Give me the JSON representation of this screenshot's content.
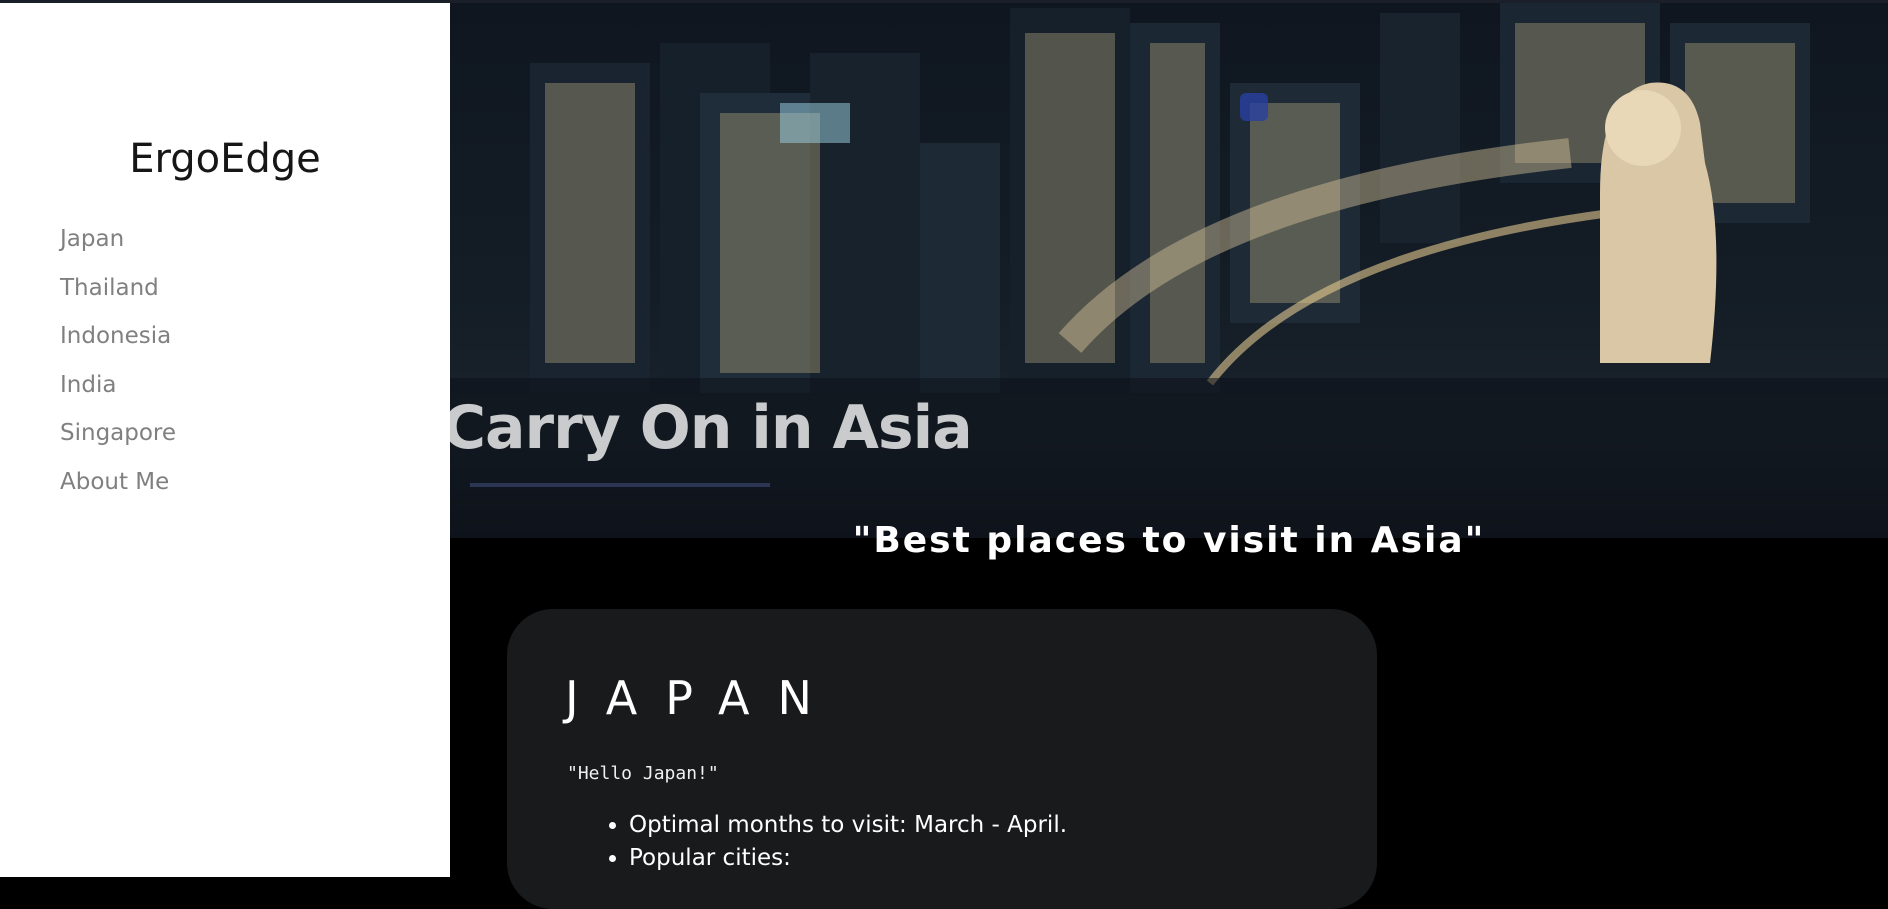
{
  "sidebar": {
    "brand": "ErgoEdge",
    "items": [
      {
        "label": "Japan"
      },
      {
        "label": "Thailand"
      },
      {
        "label": "Indonesia"
      },
      {
        "label": "India"
      },
      {
        "label": "Singapore"
      },
      {
        "label": "About Me"
      }
    ]
  },
  "hero": {
    "title": "Carry On in Asia",
    "image_description_icon": "city-night-skyline-image"
  },
  "main": {
    "subtitle": "\"Best places to visit in Asia\""
  },
  "card": {
    "title": "JAPAN",
    "quote": "\"Hello Japan!\"",
    "bullets": [
      "Optimal months to visit: March - April.",
      "Popular cities:"
    ]
  },
  "colors": {
    "sidebar_bg": "#ffffff",
    "page_bg": "#000000",
    "card_bg": "#181a1c",
    "nav_text": "#808080"
  }
}
